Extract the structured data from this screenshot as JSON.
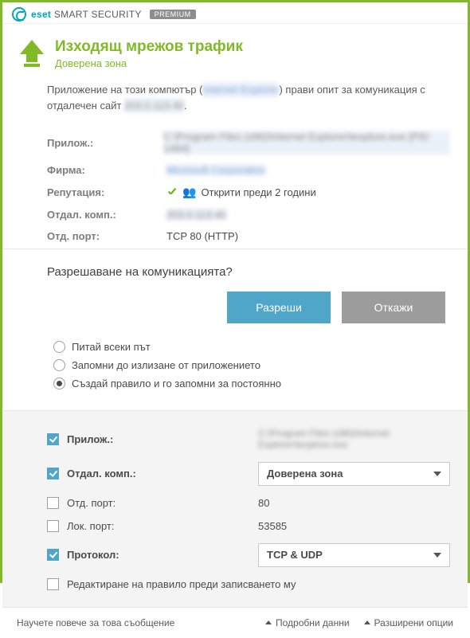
{
  "brand": {
    "eset": "eset",
    "product": "SMART SECURITY",
    "tier": "PREMIUM"
  },
  "header": {
    "title": "Изходящ мрежов трафик",
    "subtitle": "Доверена зона"
  },
  "intro": {
    "pre": "Приложение на този компютър (",
    "app_blur": "Internet Explorer",
    "mid": ") прави опит за комуникация с отдалечен сайт ",
    "site_blur": "203.0.113.40"
  },
  "details": {
    "app_label": "Прилож.:",
    "app_value_blur": "C:\\Program Files (x86)\\Internet Explorer\\iexplore.exe [PID 1484]",
    "company_label": "Фирма:",
    "company_value_blur": "Microsoft Corporation",
    "reputation_label": "Репутация:",
    "reputation_value": "Открити преди 2 години",
    "remote_label": "Отдал. комп.:",
    "remote_value_blur": "203.0.113.40",
    "remote_port_label": "Отд. порт:",
    "remote_port_value": "TCP 80 (HTTP)"
  },
  "question": "Разрешаване на комуникацията?",
  "buttons": {
    "allow": "Разреши",
    "deny": "Откажи"
  },
  "radios": {
    "ask": "Питай всеки път",
    "until_quit": "Запомни до излизане от приложението",
    "create_rule": "Създай правило и го запомни за постоянно"
  },
  "rule": {
    "app_label": "Прилож.:",
    "app_value_blur": "C:\\Program Files (x86)\\Internet Explorer\\iexplore.exe",
    "remote_label": "Отдал. комп.:",
    "remote_value": "Доверена зона",
    "remote_port_label": "Отд. порт:",
    "remote_port_value": "80",
    "local_port_label": "Лок. порт:",
    "local_port_value": "53585",
    "protocol_label": "Протокол:",
    "protocol_value": "TCP & UDP",
    "edit_before_save": "Редактиране на правило преди записването му"
  },
  "footer": {
    "learn": "Научете повече за това съобщение",
    "details": "Подробни данни",
    "advanced": "Разширени опции"
  }
}
